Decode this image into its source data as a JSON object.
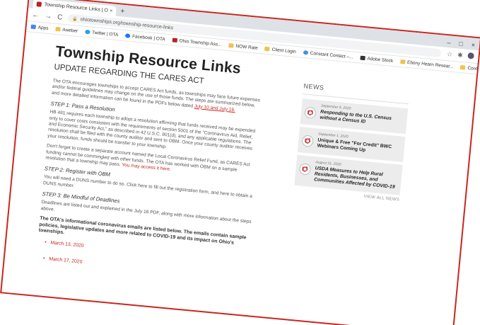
{
  "browser": {
    "tab_title": "Township Resource Links | Ohi...",
    "tab_close": "×",
    "new_tab": "+",
    "url": "ohiotownships.org/township-resource-links",
    "win_min": "–",
    "win_max": "□",
    "win_close": "×",
    "back": "←",
    "forward": "→",
    "reload": "C",
    "bookmarks": [
      {
        "label": "Apps",
        "icon": "grid"
      },
      {
        "label": "Aweber",
        "icon": "folder"
      },
      {
        "label": "Twitter | OTA",
        "icon": "tw"
      },
      {
        "label": "Facebook | OTA",
        "icon": "fb"
      },
      {
        "label": "Ohio Township Ass...",
        "icon": "red"
      },
      {
        "label": "NOW Rate",
        "icon": "folder"
      },
      {
        "label": "Client Login",
        "icon": "folder"
      },
      {
        "label": "Constant Contact –...",
        "icon": "globe"
      },
      {
        "label": "Adobe Stock",
        "icon": "dark"
      },
      {
        "label": "Ebony Hearn Resear...",
        "icon": "folder"
      },
      {
        "label": "Contract Research",
        "icon": "folder"
      }
    ],
    "ext_icons": [
      "☆",
      "✱",
      "●"
    ]
  },
  "page": {
    "title": "Township Resource Links",
    "subtitle": "UPDATE REGARDING THE CARES ACT",
    "intro": "The OTA encourages townships to accept CARES Act funds, as townships may face future expenses and/or federal guidelines may change on the use of those funds. The steps are summarized below, and more detailed information can be found in the PDFs below dated",
    "intro_link": "July 10 and July 16.",
    "step1": "STEP 1: Pass a Resolution",
    "step1_text": "HB 481 requires each township to adopt a resolution affirming that funds received may be expended only to cover costs consistent with the requirements of section 5001 of the \"Coronavirus Aid, Relief, and Economic Security Act,\" as described in 42 U.S.C. 801(d), and any applicable regulations. The resolution shall be filed with the county auditor and sent to OBM. Once your county auditor receives your resolution, funds should be transfer to your township.",
    "step1_text2": "Don't forget to create a separate account named the Local Coronavirus Relief Fund, as CARES Act funding cannot be commingled with other funds. The OTA has worked with OBM on a sample resolution that a township may pass.",
    "step1_link": "You may access it here.",
    "step2": "STEP 2: Register with OBM",
    "step2_text": "You will need a DUNS number to do so. Click here to fill out the registration form, and here to obtain a DUNS number.",
    "step3": "STEP 3: Be Mindful of Deadlines",
    "step3_text": "Deadlines are listed out and explained in the July 16 PDF, along with more information about the steps above.",
    "emails_text": "The OTA's informational coronavirus emails are listed below. The emails contain sample policies, legislative updates and more related to COVID-19 and its impact on Ohio's townships.",
    "links": [
      "March 13, 2020",
      "March 17, 2020"
    ]
  },
  "news": {
    "heading": "NEWS",
    "items": [
      {
        "date": "September 9, 2020",
        "title": "Responding to the U.S. Census without a Census ID",
        "italic": true
      },
      {
        "date": "September 1, 2020",
        "title": "Unique & Free \"For Credit\" BWC Webinars Coming Up",
        "italic": false
      },
      {
        "date": "August 31, 2020",
        "title": "USDA Measures to Help Rural Residents, Businesses, and Communities Affected by COVID-19",
        "italic": true
      }
    ],
    "view_all": "VIEW ALL NEWS"
  },
  "colors": {
    "accent": "#c9261f",
    "news_bg": "#ececec"
  }
}
